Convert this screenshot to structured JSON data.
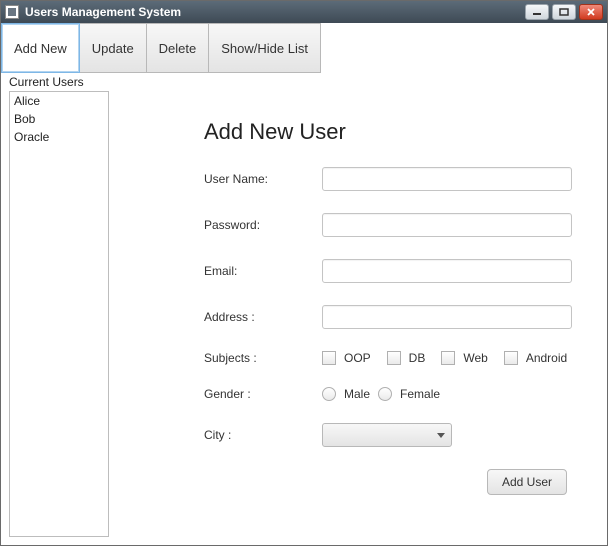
{
  "window": {
    "title": "Users Management System"
  },
  "toolbar": {
    "add_new": "Add New",
    "update": "Update",
    "delete": "Delete",
    "show_hide": "Show/Hide List"
  },
  "list": {
    "label": "Current Users",
    "items": [
      "Alice",
      "Bob",
      "Oracle"
    ]
  },
  "form": {
    "title": "Add New User",
    "labels": {
      "username": "User Name:",
      "password": "Password:",
      "email": "Email:",
      "address": "Address :",
      "subjects": "Subjects :",
      "gender": "Gender :",
      "city": "City :"
    },
    "subjects": {
      "oop": "OOP",
      "db": "DB",
      "web": "Web",
      "android": "Android"
    },
    "gender": {
      "male": "Male",
      "female": "Female"
    },
    "values": {
      "username": "",
      "password": "",
      "email": "",
      "address": "",
      "city": ""
    },
    "submit": "Add User"
  }
}
